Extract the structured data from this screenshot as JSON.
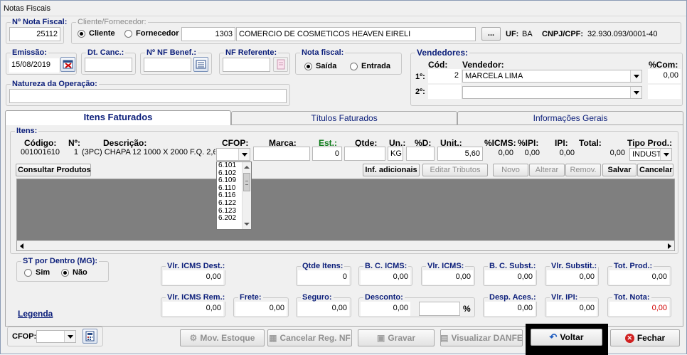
{
  "window": {
    "title": "Notas Fiscais"
  },
  "nota_fiscal": {
    "label": "Nº Nota Fiscal:",
    "value": "25112"
  },
  "cliente_fornecedor": {
    "label": "Cliente/Fornecedor:",
    "radio_cliente": "Cliente",
    "radio_fornecedor": "Fornecedor",
    "selected": "Cliente",
    "code": "1303",
    "name": "COMERCIO DE COSMETICOS HEAVEN EIRELI",
    "browse_label": "...",
    "uf_label": "UF:",
    "uf_value": "BA",
    "cnpj_label": "CNPJ/CPF:",
    "cnpj_value": "32.930.093/0001-40"
  },
  "emissao": {
    "label": "Emissão:",
    "value": "15/08/2019"
  },
  "dt_canc": {
    "label": "Dt. Canc.:",
    "value": ""
  },
  "nf_benef": {
    "label": "Nº NF Benef.:",
    "value": ""
  },
  "nf_referente": {
    "label": "NF Referente:",
    "value": ""
  },
  "nota_tipo": {
    "label": "Nota fiscal:",
    "saida": "Saída",
    "entrada": "Entrada",
    "selected": "Saída"
  },
  "natureza": {
    "label": "Natureza da Operação:",
    "value": ""
  },
  "vendedores": {
    "label": "Vendedores:",
    "cod_header": "Cód:",
    "vendedor_header": "Vendedor:",
    "com_header": "%Com:",
    "rows": [
      {
        "pos": "1º:",
        "cod": "2",
        "name": "MARCELA LIMA",
        "com": "0,00"
      },
      {
        "pos": "2º:",
        "cod": "",
        "name": "",
        "com": ""
      }
    ]
  },
  "tabs": [
    {
      "label": "Itens Faturados",
      "active": true
    },
    {
      "label": "Títulos Faturados",
      "active": false
    },
    {
      "label": "Informações Gerais",
      "active": false
    }
  ],
  "itens": {
    "label": "Itens:",
    "headers": {
      "codigo": "Código:",
      "numero": "Nº:",
      "descricao": "Descrição:",
      "cfop": "CFOP:",
      "marca": "Marca:",
      "est": "Est.:",
      "qtde": "Qtde:",
      "un": "Un.:",
      "pd": "%D:",
      "unit": "Unit.:",
      "icms": "%ICMS:",
      "ipi_pct": "%IPI:",
      "ipi": "IPI:",
      "total": "Total:",
      "tipo_prod": "Tipo Prod.:"
    },
    "row": {
      "codigo": "001001610",
      "numero": "1",
      "descricao": "(3PC) CHAPA 12 1000 X 2000 F.Q. 2,65M",
      "cfop": "",
      "marca": "",
      "est": "0",
      "qtde": "",
      "un": "KG",
      "pd": "",
      "unit": "5,60",
      "icms": "0,00",
      "ipi_pct": "0,00",
      "ipi": "0,00",
      "total": "0,00",
      "tipo_prod": "INDUST..."
    },
    "cfop_options": [
      "6.101",
      "6.102",
      "6.109",
      "6.110",
      "6.116",
      "6.122",
      "6.123",
      "6.202"
    ]
  },
  "item_buttons": {
    "consultar": "Consultar Produtos",
    "inf_adicionais": "Inf. adicionais",
    "editar_tributos": "Editar Tributos",
    "novo": "Novo",
    "alterar": "Alterar",
    "remover": "Remov.",
    "salvar": "Salvar",
    "cancelar": "Cancelar"
  },
  "st_dentro": {
    "label": "ST por Dentro (MG):",
    "sim": "Sim",
    "nao": "Não",
    "selected": "Não"
  },
  "totais": {
    "vlr_icms_dest": {
      "label": "Vlr. ICMS Dest.:",
      "value": "0,00"
    },
    "qtde_itens": {
      "label": "Qtde Itens:",
      "value": "0"
    },
    "bc_icms": {
      "label": "B. C. ICMS:",
      "value": "0,00"
    },
    "vlr_icms": {
      "label": "Vlr. ICMS:",
      "value": "0,00"
    },
    "bc_subst": {
      "label": "B. C. Subst.:",
      "value": "0,00"
    },
    "vlr_substit": {
      "label": "Vlr. Substit.:",
      "value": "0,00"
    },
    "tot_prod": {
      "label": "Tot. Prod.:",
      "value": "0,00"
    },
    "vlr_icms_rem": {
      "label": "Vlr. ICMS Rem.:",
      "value": "0,00"
    },
    "frete": {
      "label": "Frete:",
      "value": "0,00"
    },
    "seguro": {
      "label": "Seguro:",
      "value": "0,00"
    },
    "desconto": {
      "label": "Desconto:",
      "value": "0,00",
      "pct_value": "",
      "pct_sign": "%"
    },
    "desp_aces": {
      "label": "Desp. Aces.:",
      "value": "0,00"
    },
    "vlr_ipi": {
      "label": "Vlr. IPI:",
      "value": "0,00"
    },
    "tot_nota": {
      "label": "Tot. Nota:",
      "value": "0,00"
    }
  },
  "legenda": "Legenda",
  "footer": {
    "cfop_label": "CFOP:",
    "cfop_value": "",
    "mov_estoque": "Mov. Estoque",
    "cancelar_reg": "Cancelar Reg. NF",
    "gravar": "Gravar",
    "visualizar_danfe": "Visualizar DANFE",
    "voltar": "Voltar",
    "fechar": "Fechar"
  }
}
